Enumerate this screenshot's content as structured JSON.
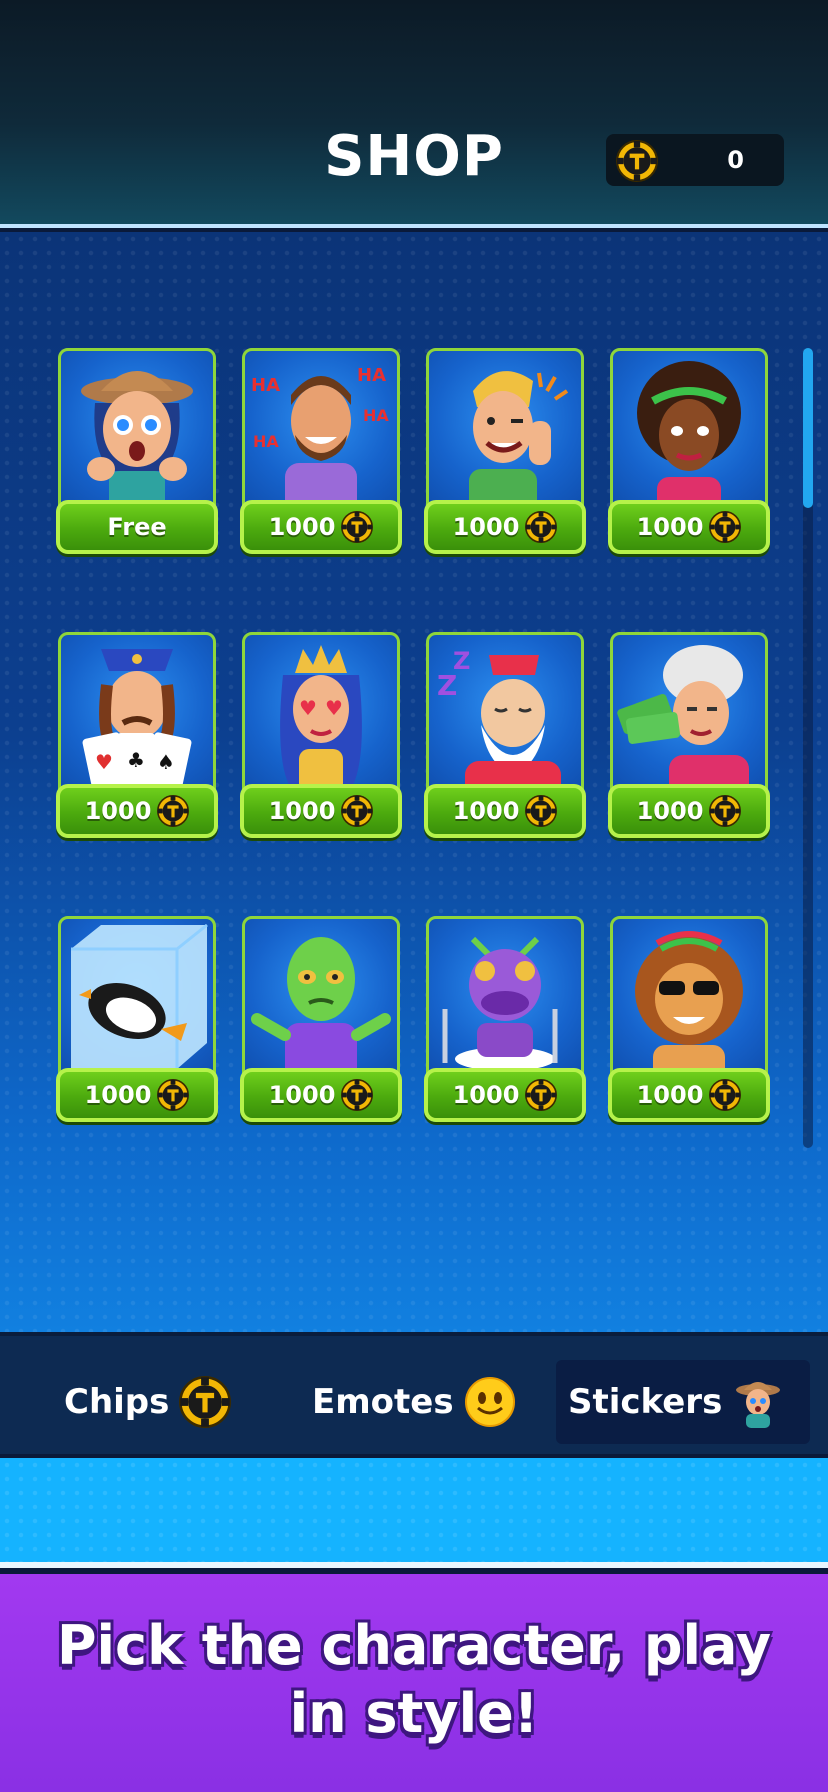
{
  "header": {
    "title": "SHOP",
    "balance": "0"
  },
  "stickers": [
    {
      "name": "explorer-woman",
      "price": "Free"
    },
    {
      "name": "laughing-man",
      "price": "1000"
    },
    {
      "name": "thumbs-up-boy",
      "price": "1000"
    },
    {
      "name": "curly-hair-woman",
      "price": "1000"
    },
    {
      "name": "police-card-player",
      "price": "1000"
    },
    {
      "name": "love-eyes-queen",
      "price": "1000"
    },
    {
      "name": "sleeping-king",
      "price": "1000"
    },
    {
      "name": "money-granny",
      "price": "1000"
    },
    {
      "name": "frozen-penguin",
      "price": "1000"
    },
    {
      "name": "shrugging-alien",
      "price": "1000"
    },
    {
      "name": "hungry-purple-monster",
      "price": "1000"
    },
    {
      "name": "cool-lion",
      "price": "1000"
    }
  ],
  "tabs": {
    "chips": "Chips",
    "emotes": "Emotes",
    "stickers": "Stickers",
    "active": "stickers"
  },
  "promo": {
    "line1": "Pick the character, play",
    "line2": "in style!"
  },
  "colors": {
    "button_green": "#4caa0e",
    "button_border": "#b6f24a",
    "promo_purple": "#9a35ec",
    "header_dark": "#0c1a26",
    "chip_gold": "#f2b705"
  },
  "icons": {
    "currency": "poker-chip-icon",
    "emote": "smiley-face-icon",
    "sticker_tab": "explorer-woman-icon"
  }
}
